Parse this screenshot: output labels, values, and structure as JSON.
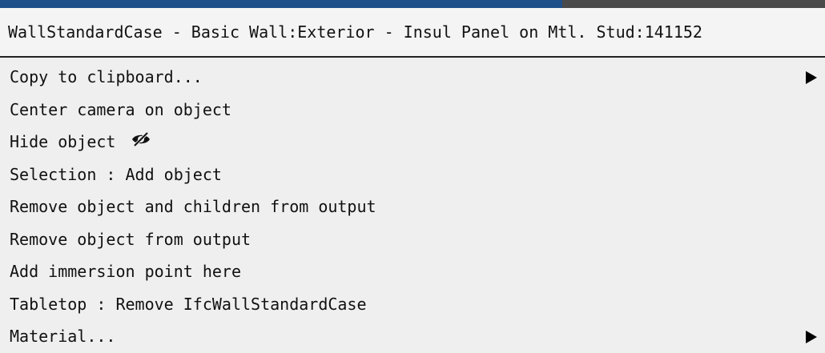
{
  "menu": {
    "header": "WallStandardCase - Basic Wall:Exterior - Insul Panel on Mtl. Stud:141152",
    "items": [
      {
        "label": "Copy to clipboard...",
        "has_submenu": true
      },
      {
        "label": "Center camera on object",
        "has_submenu": false
      },
      {
        "label": "Hide object",
        "icon": "eye-slash-icon",
        "has_submenu": false
      },
      {
        "label": "Selection : Add object",
        "has_submenu": false
      },
      {
        "label": "Remove object and children from output",
        "has_submenu": false
      },
      {
        "label": "Remove object from output",
        "has_submenu": false
      },
      {
        "label": "Add immersion point here",
        "has_submenu": false
      },
      {
        "label": "Tabletop : Remove IfcWallStandardCase",
        "has_submenu": false
      },
      {
        "label": "Material...",
        "has_submenu": true
      }
    ]
  },
  "colors": {
    "topbar_accent": "#20508a",
    "topbar_dark": "#4a4a4a",
    "menu_background": "#efefef",
    "text": "#111111"
  }
}
